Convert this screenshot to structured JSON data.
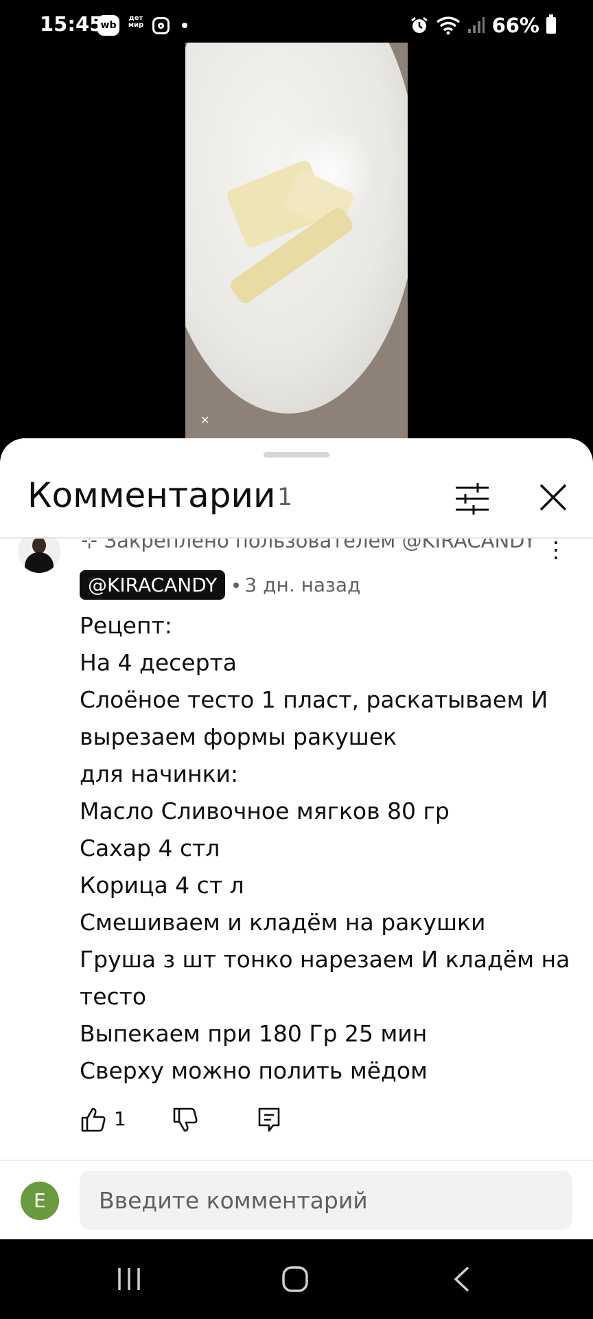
{
  "status_bar": {
    "time": "15:45",
    "wb_badge": "wb",
    "detmir_badge": "дет мир",
    "battery": "66%"
  },
  "video": {
    "watermark_icon": "capcut-icon"
  },
  "comments_sheet": {
    "title": "Комментарии",
    "count": "1",
    "pinned_note": "Закреплено пользователем @KIRACANDY",
    "comment": {
      "author": "@KIRACANDY",
      "time": "3 дн. назад",
      "lines": [
        "Рецепт:",
        "На 4 десерта",
        "Слоёное тесто 1 пласт, раскатываем И",
        "вырезаем формы ракушек",
        "для начинки:",
        "Масло Сливочное мягков 80 гр",
        "Сахар 4 стл",
        "Корица 4 ст л",
        "Смешиваем и кладём на ракушки",
        "Груша з шт тонко нарезаем И кладём на",
        "тесто",
        "Выпекаем при 180 Гр 25 мин",
        "Сверху можно полить мёдом"
      ],
      "like_count": "1"
    },
    "input": {
      "user_initial": "E",
      "placeholder": "Введите комментарий"
    }
  },
  "colors": {
    "sheet_bg": "#ffffff",
    "text_primary": "#0f0f0f",
    "text_secondary": "#606060",
    "user_avatar": "#6a9a3f"
  }
}
